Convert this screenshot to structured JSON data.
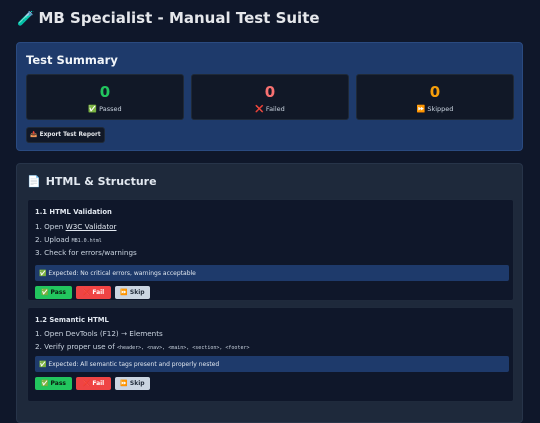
{
  "header": {
    "icon": "test-tube-icon",
    "icon_glyph": "🧪",
    "title": "MB Specialist - Manual Test Suite"
  },
  "summary": {
    "title": "Test Summary",
    "stats": [
      {
        "value": "0",
        "label": "Passed",
        "icon": "check-icon",
        "glyph": "✅",
        "color": "#22c55e"
      },
      {
        "value": "0",
        "label": "Failed",
        "icon": "cross-icon",
        "glyph": "❌",
        "color": "#f87171"
      },
      {
        "value": "0",
        "label": "Skipped",
        "icon": "skip-icon",
        "glyph": "⏩",
        "color": "#f59e0b"
      }
    ],
    "export_label": "Export Test Report",
    "export_glyph": "📤"
  },
  "section": {
    "icon_glyph": "📄",
    "title": "HTML & Structure",
    "cards": [
      {
        "title": "1.1 HTML Validation",
        "step1_prefix": "1. Open ",
        "step1_link": "W3C Validator",
        "step2_prefix": "2. Upload ",
        "step2_code": "MB1.0.html",
        "step3": "3. Check for errors/warnings",
        "expected": "✅ Expected: No critical errors, warnings acceptable"
      },
      {
        "title": "1.2 Semantic HTML",
        "step1": "1. Open DevTools (F12) → Elements",
        "step2_prefix": "2. Verify proper use of ",
        "step2_code": "<header>, <nav>, <main>, <section>, <footer>",
        "expected": "✅ Expected: All semantic tags present and properly nested"
      }
    ],
    "buttons": {
      "pass": "✅ Pass",
      "fail": "❌ Fail",
      "skip": "⏩ Skip"
    }
  }
}
